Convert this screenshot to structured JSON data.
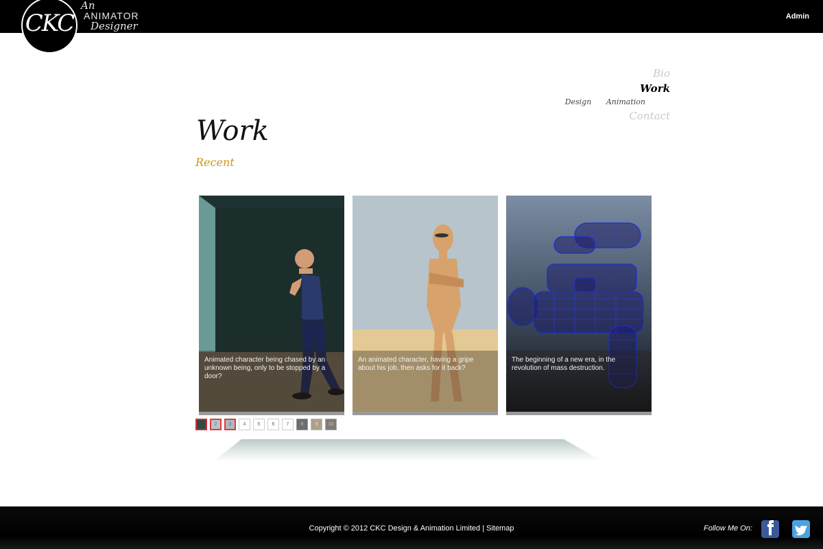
{
  "header": {
    "logo_text": "CKC",
    "tagline": {
      "line1": "An",
      "line2": "ANIMATOR",
      "line3": "Designer"
    },
    "admin_label": "Admin"
  },
  "nav": {
    "bio": "Bio",
    "work": "Work",
    "sub_design": "Design",
    "sub_animation": "Animation",
    "contact": "Contact"
  },
  "main": {
    "title": "Work",
    "subtitle": "Recent",
    "cards": [
      {
        "caption": "Animated character being chased by an unknown being, only to be stopped by a door?"
      },
      {
        "caption": "An animated character, having a gripe about his job, then asks for it back?"
      },
      {
        "caption": "The beginning of a new era, in the revolution of mass destruction."
      }
    ],
    "pager": [
      "1",
      "2",
      "3",
      "4",
      "5",
      "6",
      "7",
      "8",
      "9",
      "10"
    ]
  },
  "footer": {
    "copyright": "Copyright © 2012 CKC Design & Animation Limited | Sitemap",
    "follow": "Follow Me On:"
  },
  "colors": {
    "accent_gold": "#c9961a",
    "facebook": "#3b5998",
    "twitter": "#4aa3df"
  }
}
